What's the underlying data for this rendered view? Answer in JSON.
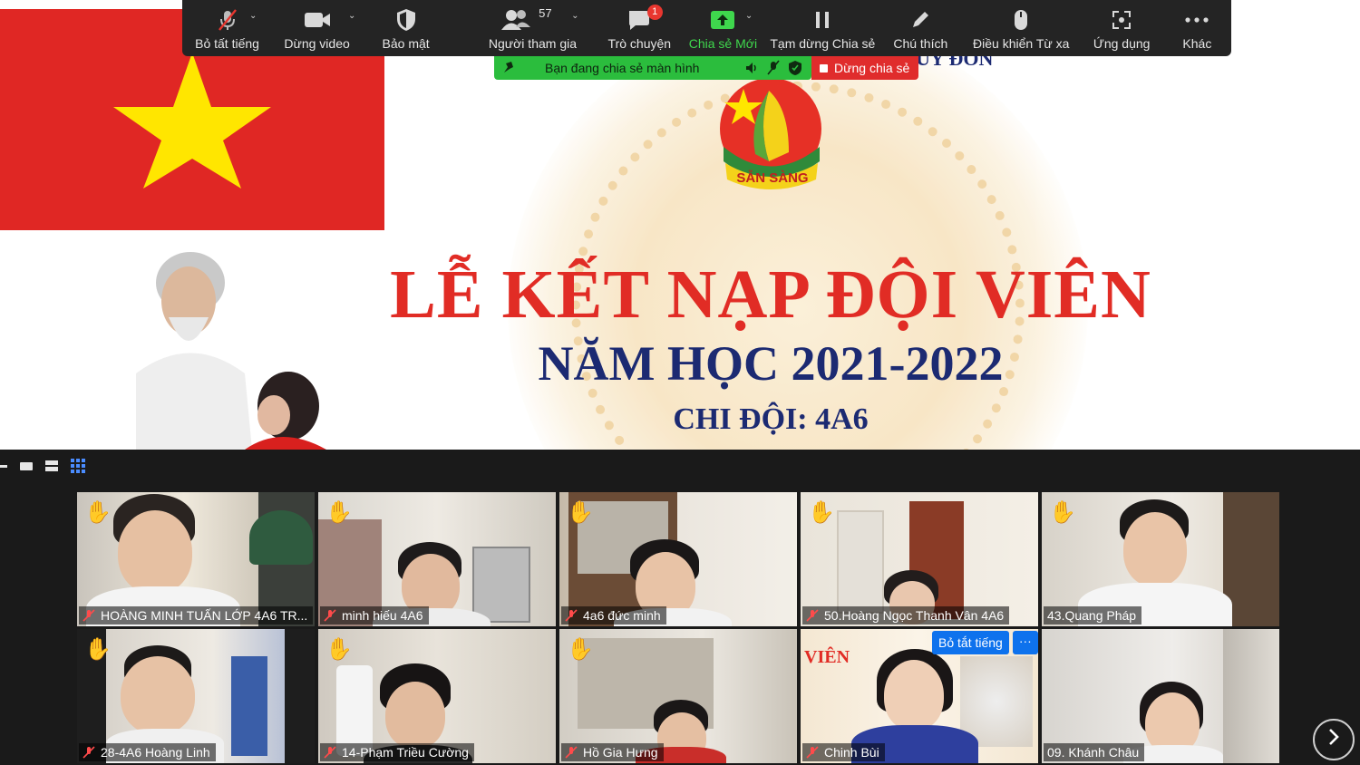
{
  "toolbar": {
    "items": [
      {
        "label": "Bỏ tất tiếng",
        "icon": "mic-muted-icon"
      },
      {
        "label": "Dừng video",
        "icon": "video-camera-icon"
      },
      {
        "label": "Bảo mật",
        "icon": "shield-icon"
      },
      {
        "label": "Người tham gia",
        "icon": "participants-icon",
        "count": "57"
      },
      {
        "label": "Trò chuyện",
        "icon": "chat-bubble-icon",
        "badge": "1"
      },
      {
        "label": "Chia sẻ Mới",
        "icon": "share-screen-icon"
      },
      {
        "label": "Tạm dừng Chia sẻ",
        "icon": "pause-icon"
      },
      {
        "label": "Chú thích",
        "icon": "pencil-icon"
      },
      {
        "label": "Điều khiển Từ xa",
        "icon": "mouse-icon"
      },
      {
        "label": "Ứng dụng",
        "icon": "apps-icon"
      },
      {
        "label": "Khác",
        "icon": "more-dots-icon"
      }
    ]
  },
  "sharebar": {
    "status": "Bạn đang chia sẻ màn hình",
    "stop_label": "Dừng chia sẻ"
  },
  "slide": {
    "title": "LỄ KẾT NẠP ĐỘI VIÊN",
    "subtitle": "NĂM HỌC 2021-2022",
    "unit": "CHI ĐỘI: 4A6",
    "badge_text": "SẴN SÀNG",
    "partial_text": "UY ĐÔN"
  },
  "gallery": {
    "tiles": [
      {
        "name": "HOÀNG MINH TUẤN LỚP 4A6 TR...",
        "hand": true
      },
      {
        "name": "minh hiếu 4A6",
        "hand": true
      },
      {
        "name": "4a6 đức minh",
        "hand": true
      },
      {
        "name": "50.Hoàng Ngọc Thanh Vân 4A6",
        "hand": true
      },
      {
        "name": "43.Quang Pháp",
        "hand": true
      },
      {
        "name": "28-4A6 Hoàng Linh",
        "hand": true
      },
      {
        "name": "14-Phạm Triều Cường",
        "hand": true
      },
      {
        "name": "Hồ Gia Hưng",
        "hand": true
      },
      {
        "name": "Chinh Bùi",
        "hand": false
      },
      {
        "name": "09. Khánh Châu",
        "hand": false
      }
    ],
    "mute_button": "Bỏ tắt tiếng",
    "more_button": "···"
  },
  "colors": {
    "accent": "#3fd74d",
    "danger": "#e02c2c",
    "toolbar": "#242424",
    "slide_red": "#e12c25",
    "slide_navy": "#1c2a72"
  }
}
